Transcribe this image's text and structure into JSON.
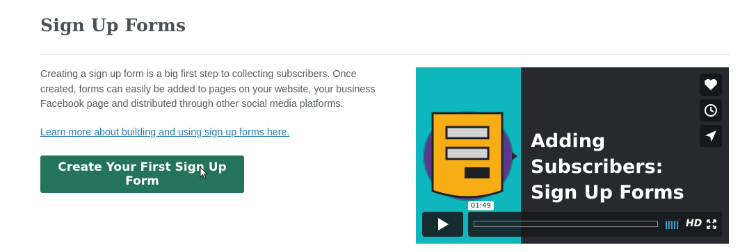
{
  "page": {
    "title": "Sign Up Forms",
    "intro": "Creating a sign up form is a big first step to collecting subscribers. Once created, forms can easily be added to pages on your website, your business Facebook page and distributed through other social media platforms.",
    "learn_link": "Learn more about building and using sign up forms here.",
    "cta_label": "Create Your First Sign Up Form"
  },
  "video": {
    "title": "Adding Subscribers:\nSign Up Forms",
    "duration": "01:49",
    "hd_label": "HD",
    "progress": 0.0,
    "side_buttons": [
      "heart-icon",
      "clock-icon",
      "send-icon"
    ]
  },
  "colors": {
    "cta": "#23745a",
    "link": "#2a7ab0",
    "video_teal": "#0db7bd",
    "video_dark": "#26292d",
    "doc_yellow": "#f7ae15",
    "doc_purple": "#5a3a8f"
  }
}
